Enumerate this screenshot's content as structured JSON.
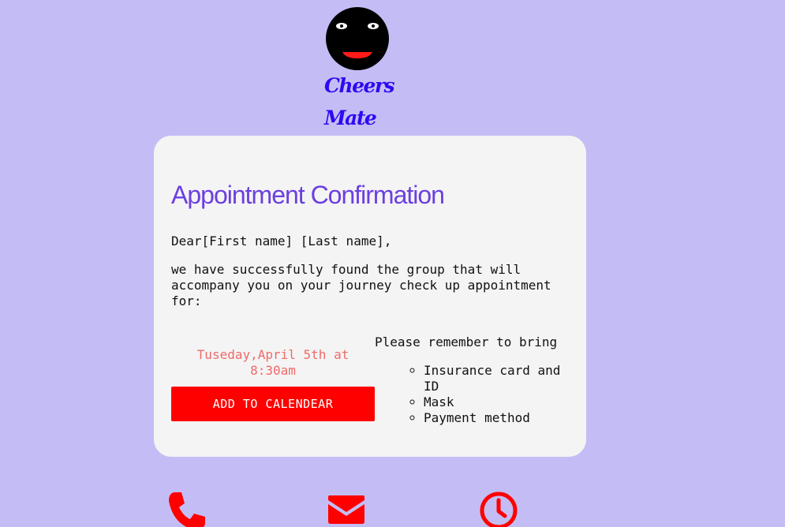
{
  "brand": {
    "logo_icon": "smiling-face-logo-icon",
    "name": "Cheers Mate",
    "color": "#2d0af2"
  },
  "card": {
    "title": "Appointment Confirmation",
    "greeting": "Dear[First name] [Last name],",
    "message": "we have successfully found the group that will accompany you on your journey check up appointment for:",
    "appointment_date": "Tuseday,April 5th at 8:30am",
    "calendar_button_label": "ADD TO CALENDEAR",
    "bring_title": "Please remember to bring",
    "bring_items": [
      "Insurance card and ID",
      "Mask",
      "Payment method"
    ]
  },
  "contact_icons": [
    "phone-icon",
    "mail-icon",
    "clock-icon"
  ],
  "colors": {
    "background": "#c4bdf5",
    "card": "#f4f4f4",
    "title": "#6c3fe0",
    "date": "#f06a6a",
    "accent": "#ff0000"
  }
}
